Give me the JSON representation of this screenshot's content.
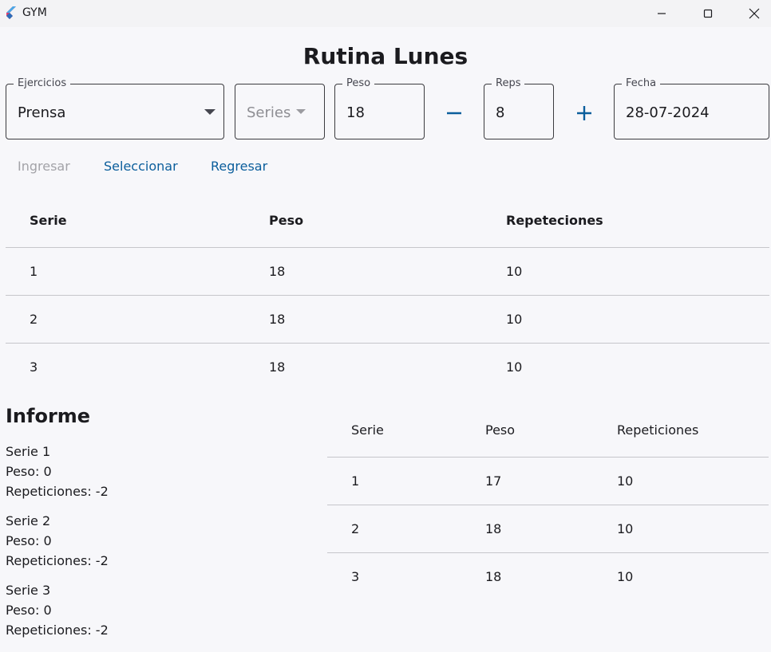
{
  "window": {
    "title": "GYM"
  },
  "page": {
    "title": "Rutina Lunes"
  },
  "form": {
    "ejercicios": {
      "label": "Ejercicios",
      "value": "Prensa"
    },
    "series": {
      "placeholder": "Series"
    },
    "peso": {
      "label": "Peso",
      "value": "18"
    },
    "reps": {
      "label": "Reps",
      "value": "8"
    },
    "fecha": {
      "label": "Fecha",
      "value": "28-07-2024"
    }
  },
  "actions": {
    "ingresar": "Ingresar",
    "seleccionar": "Seleccionar",
    "regresar": "Regresar"
  },
  "main_table": {
    "headers": [
      "Serie",
      "Peso",
      "Repeteciones"
    ],
    "rows": [
      [
        "1",
        "18",
        "10"
      ],
      [
        "2",
        "18",
        "10"
      ],
      [
        "3",
        "18",
        "10"
      ]
    ]
  },
  "informe": {
    "title": "Informe",
    "items": [
      {
        "serie": "Serie 1",
        "peso": "Peso: 0",
        "reps": "Repeticiones: -2"
      },
      {
        "serie": "Serie 2",
        "peso": "Peso: 0",
        "reps": "Repeticiones: -2"
      },
      {
        "serie": "Serie 3",
        "peso": "Peso: 0",
        "reps": "Repeticiones: -2"
      }
    ]
  },
  "side_table": {
    "headers": [
      "Serie",
      "Peso",
      "Repeticiones"
    ],
    "rows": [
      [
        "1",
        "17",
        "10"
      ],
      [
        "2",
        "18",
        "10"
      ],
      [
        "3",
        "18",
        "10"
      ]
    ]
  },
  "icons": {
    "app": "flutter-logo-icon",
    "minimize": "minimize-icon",
    "maximize": "maximize-icon",
    "close": "close-icon",
    "minus": "minus-icon",
    "plus": "plus-icon",
    "dropdown": "dropdown-arrow-icon"
  },
  "colors": {
    "accent": "#0b5e9c",
    "disabled": "#a3a3a8",
    "background": "#f7f7fa"
  }
}
